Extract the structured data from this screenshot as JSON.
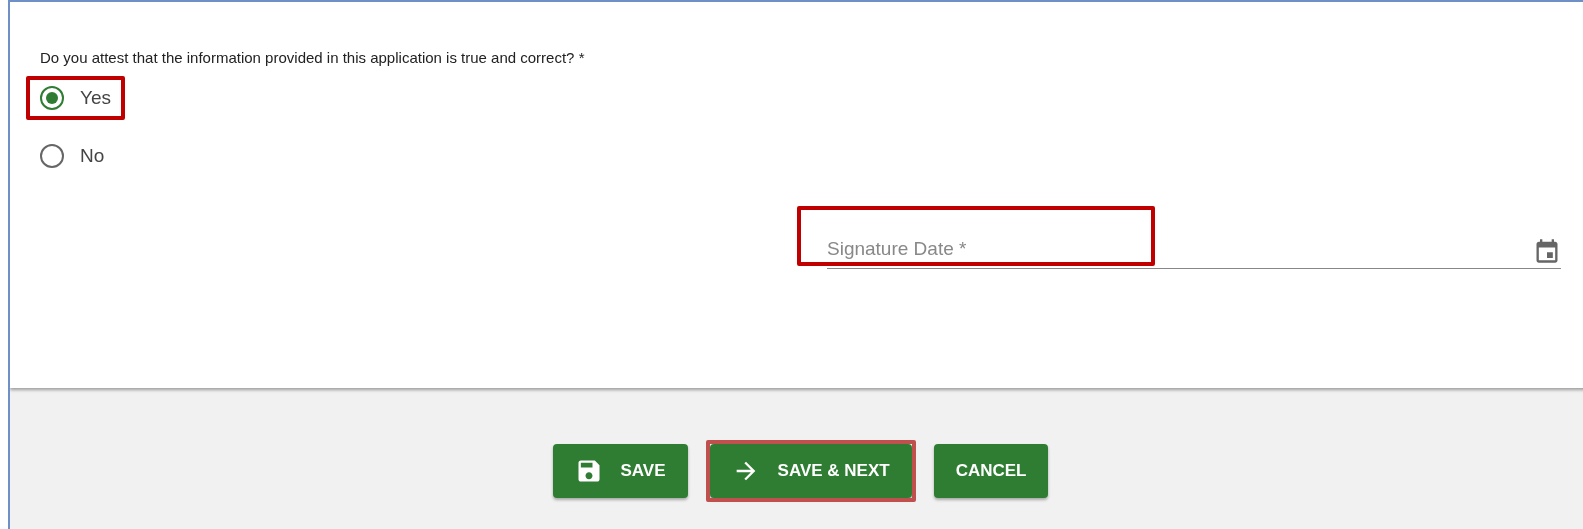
{
  "question": "Do you attest that the information provided in this application is true and correct? *",
  "options": [
    {
      "label": "Yes",
      "selected": true,
      "highlighted": true
    },
    {
      "label": "No",
      "selected": false,
      "highlighted": false
    }
  ],
  "date_field": {
    "placeholder": "Signature Date *",
    "highlighted": true
  },
  "buttons": [
    {
      "label": "SAVE",
      "kind": "save",
      "highlighted": false
    },
    {
      "label": "SAVE & NEXT",
      "kind": "next",
      "highlighted": true
    },
    {
      "label": "CANCEL",
      "kind": "cancel",
      "highlighted": false
    }
  ]
}
